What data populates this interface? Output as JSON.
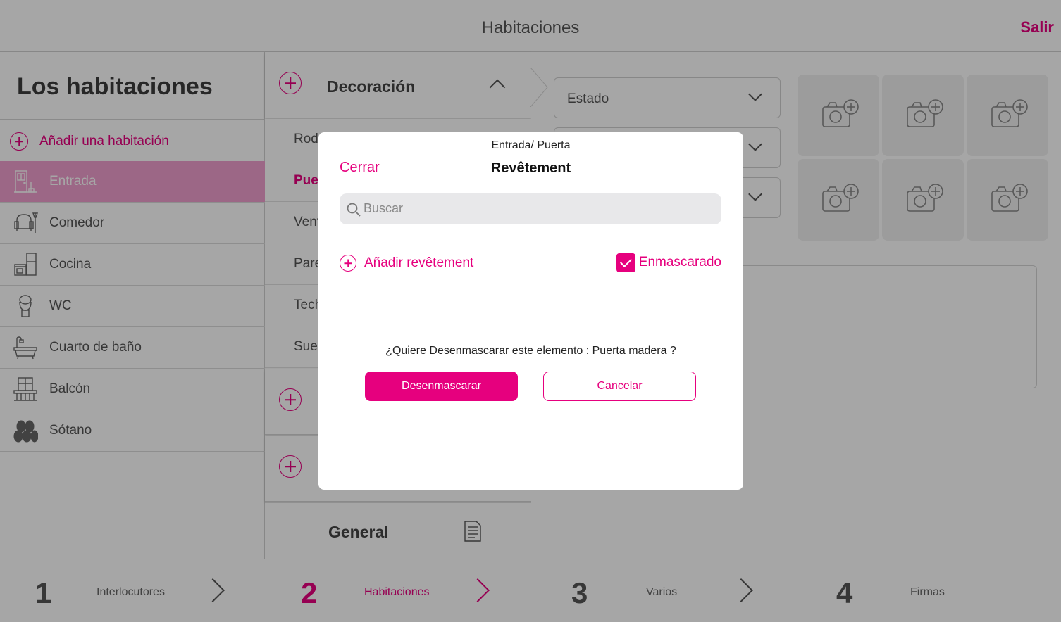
{
  "header": {
    "title": "Habitaciones",
    "exit_label": "Salir"
  },
  "sidebar": {
    "title": "Los habitaciones",
    "add_label": "Añadir una habitación",
    "rooms": [
      {
        "label": "Entrada",
        "icon": "door-icon",
        "active": true
      },
      {
        "label": "Comedor",
        "icon": "armchair-icon",
        "active": false
      },
      {
        "label": "Cocina",
        "icon": "kitchen-icon",
        "active": false
      },
      {
        "label": "WC",
        "icon": "toilet-icon",
        "active": false
      },
      {
        "label": "Cuarto de baño",
        "icon": "bathtub-icon",
        "active": false
      },
      {
        "label": "Balcón",
        "icon": "balcony-icon",
        "active": false
      },
      {
        "label": "Sótano",
        "icon": "barrels-icon",
        "active": false
      }
    ]
  },
  "sections": {
    "decoration_label": "Decoración",
    "items": [
      "Rod",
      "Puer",
      "Vent",
      "Pare",
      "Tech",
      "Suel"
    ],
    "general_label": "General"
  },
  "detail": {
    "dropdown_estado": "Estado"
  },
  "steps": [
    {
      "num": "1",
      "label": "Interlocutores",
      "active": false
    },
    {
      "num": "2",
      "label": "Habitaciones",
      "active": true
    },
    {
      "num": "3",
      "label": "Varios",
      "active": false
    },
    {
      "num": "4",
      "label": "Firmas",
      "active": false
    }
  ],
  "modal": {
    "path": "Entrada/ Puerta",
    "close_label": "Cerrar",
    "title": "Revêtement",
    "search_placeholder": "Buscar",
    "add_label": "Añadir revêtement",
    "masked_label": "Enmascarado",
    "masked_checked": true,
    "question": "¿Quiere Desenmascarar este elemento : Puerta madera ?",
    "confirm_label": "Desenmascarar",
    "cancel_label": "Cancelar"
  },
  "colors": {
    "accent": "#e6007e",
    "active_row": "#f09fce"
  }
}
